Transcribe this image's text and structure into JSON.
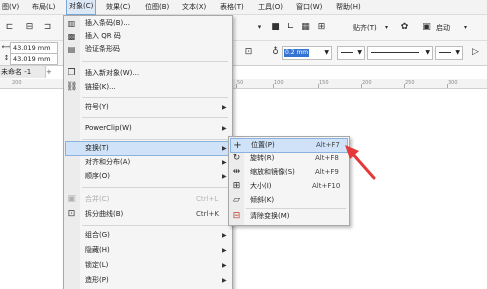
{
  "menubar": {
    "items": [
      "图(V)",
      "布局(L)",
      "对象(C)",
      "效果(C)",
      "位图(B)",
      "文本(X)",
      "表格(T)",
      "工具(O)",
      "窗口(W)",
      "帮助(H)"
    ]
  },
  "toolbar": {
    "width_value": "43.019 mm",
    "height_value": "43.019 mm",
    "outline_width": "0.2 mm",
    "snap_label": "贴齐(T)",
    "launch_label": "启动"
  },
  "doc_tab": "未命名 -1",
  "ruler": [
    "200",
    "50",
    "100",
    "150",
    "200",
    "250",
    "300"
  ],
  "object_menu": {
    "items": [
      {
        "label": "插入条码(B)...",
        "shortcut": "",
        "icon": "barcode-icon",
        "submenu": false,
        "disabled": false
      },
      {
        "label": "插入 QR 码",
        "shortcut": "",
        "icon": "qr-code-icon",
        "submenu": false,
        "disabled": false
      },
      {
        "label": "验证条形码",
        "shortcut": "",
        "icon": "barcode-check-icon",
        "submenu": false,
        "disabled": false
      },
      {
        "label": "插入新对象(W)...",
        "shortcut": "",
        "icon": "insert-object-icon",
        "submenu": false,
        "disabled": false
      },
      {
        "label": "链接(K)...",
        "shortcut": "",
        "icon": "link-icon",
        "submenu": false,
        "disabled": false
      },
      {
        "label": "符号(Y)",
        "shortcut": "",
        "icon": "",
        "submenu": true,
        "disabled": false
      },
      {
        "label": "PowerClip(W)",
        "shortcut": "",
        "icon": "",
        "submenu": true,
        "disabled": false
      },
      {
        "label": "变换(T)",
        "shortcut": "",
        "icon": "",
        "submenu": true,
        "disabled": false
      },
      {
        "label": "对齐和分布(A)",
        "shortcut": "",
        "icon": "",
        "submenu": true,
        "disabled": false
      },
      {
        "label": "顺序(O)",
        "shortcut": "",
        "icon": "",
        "submenu": true,
        "disabled": false
      },
      {
        "label": "合并(C)",
        "shortcut": "Ctrl+L",
        "icon": "combine-icon",
        "submenu": false,
        "disabled": true
      },
      {
        "label": "拆分曲线(B)",
        "shortcut": "Ctrl+K",
        "icon": "split-curve-icon",
        "submenu": false,
        "disabled": false
      },
      {
        "label": "组合(G)",
        "shortcut": "",
        "icon": "",
        "submenu": true,
        "disabled": false
      },
      {
        "label": "隐藏(H)",
        "shortcut": "",
        "icon": "",
        "submenu": true,
        "disabled": false
      },
      {
        "label": "锁定(L)",
        "shortcut": "",
        "icon": "",
        "submenu": true,
        "disabled": false
      },
      {
        "label": "造形(P)",
        "shortcut": "",
        "icon": "",
        "submenu": true,
        "disabled": false
      }
    ]
  },
  "transform_menu": {
    "items": [
      {
        "label": "位置(P)",
        "shortcut": "Alt+F7",
        "icon": "position-icon"
      },
      {
        "label": "旋转(R)",
        "shortcut": "Alt+F8",
        "icon": "rotate-icon"
      },
      {
        "label": "缩放和镜像(S)",
        "shortcut": "Alt+F9",
        "icon": "scale-mirror-icon"
      },
      {
        "label": "大小(I)",
        "shortcut": "Alt+F10",
        "icon": "size-icon"
      },
      {
        "label": "倾斜(K)",
        "shortcut": "",
        "icon": "skew-icon"
      },
      {
        "label": "清除变换(M)",
        "shortcut": "",
        "icon": "clear-transform-icon"
      }
    ]
  },
  "colors": {
    "highlight": "#cfe2f7",
    "annotation_arrow": "#e5383b"
  }
}
